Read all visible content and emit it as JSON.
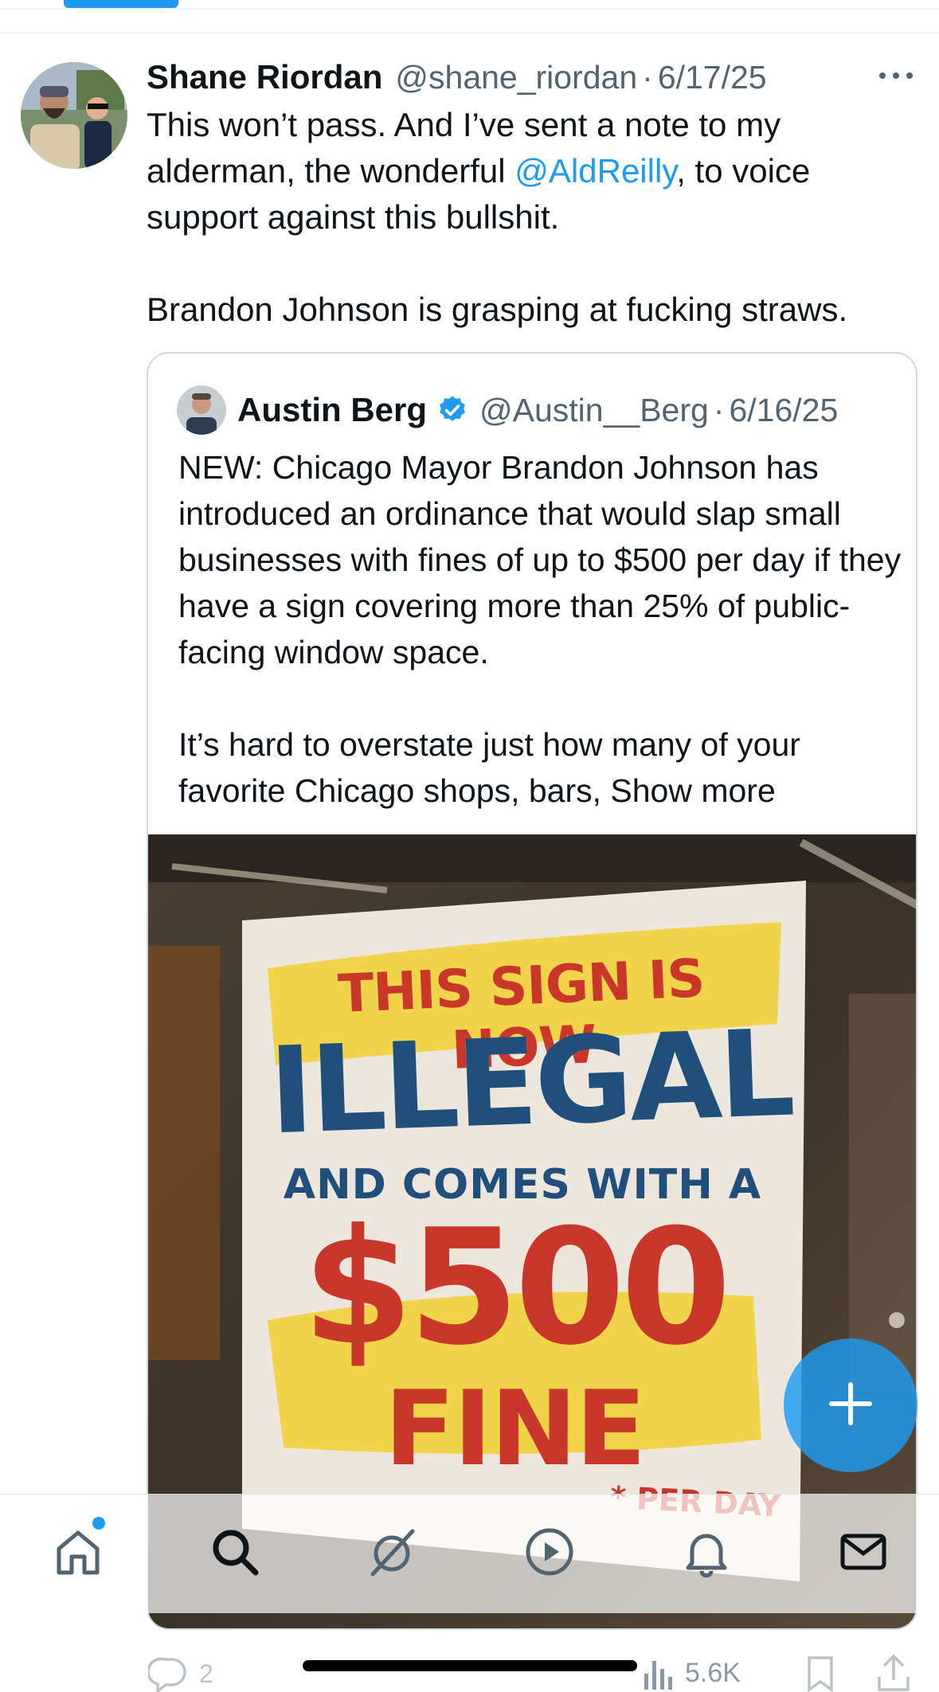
{
  "post": {
    "display_name": "Shane Riordan",
    "handle": "@shane_riordan",
    "separator": "·",
    "date": "6/17/25",
    "text_part1": "This won’t pass. And I’ve sent a note to my alderman, the wonderful ",
    "mention": "@AldReilly",
    "text_part2": ", to voice support against this bullshit.\n\nBrandon Johnson is grasping at fucking straws.",
    "more_icon": "more-horizontal-icon"
  },
  "quote": {
    "display_name": "Austin Berg",
    "verified_icon": "verified-badge-icon",
    "handle": "@Austin__Berg",
    "separator": "·",
    "date": "6/16/25",
    "text": "NEW: Chicago Mayor Brandon Johnson has introduced an ordinance that would slap small businesses with fines of up to $500 per day if they have a sign covering more than 25% of public-facing window space.\n\nIt’s hard to overstate just how many of your favorite Chicago shops, bars, ",
    "show_more": "Show more",
    "image": {
      "line1": "THIS SIGN IS NOW",
      "line2": "ILLEGAL",
      "line3": "AND COMES WITH A",
      "line4": "$500",
      "line5": "FINE",
      "footnote": "* PER DAY"
    }
  },
  "actions": {
    "reply_count": "2",
    "views_count": "5.6K"
  },
  "fab": {
    "icon": "compose-plus-icon"
  },
  "nav": {
    "items": [
      "home-icon",
      "search-icon",
      "grok-icon",
      "video-icon",
      "notifications-icon",
      "messages-icon"
    ]
  },
  "colors": {
    "accent": "#1d9bf0",
    "text": "#0f1419",
    "secondary": "#536471",
    "border": "#cfd9de",
    "sign_red": "#c8372a",
    "sign_blue": "#1f4f7a",
    "sign_yellow": "#f2d23a"
  }
}
